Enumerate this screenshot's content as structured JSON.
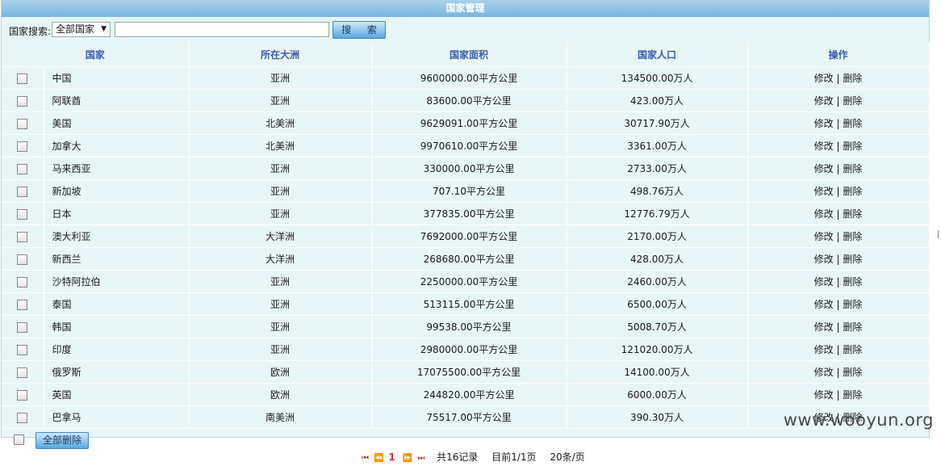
{
  "title": "国家管理",
  "search": {
    "label": "国家搜索:",
    "select_value": "全部国家",
    "input_value": "",
    "button_label": "搜 索"
  },
  "table": {
    "headers": [
      "国家",
      "所在大洲",
      "国家面积",
      "国家人口",
      "操作"
    ],
    "rows": [
      {
        "name": "中国",
        "continent": "亚洲",
        "area": "9600000.00平方公里",
        "population": "134500.00万人"
      },
      {
        "name": "阿联酋",
        "continent": "亚洲",
        "area": "83600.00平方公里",
        "population": "423.00万人"
      },
      {
        "name": "美国",
        "continent": "北美洲",
        "area": "9629091.00平方公里",
        "population": "30717.90万人"
      },
      {
        "name": "加拿大",
        "continent": "北美洲",
        "area": "9970610.00平方公里",
        "population": "3361.00万人"
      },
      {
        "name": "马来西亚",
        "continent": "亚洲",
        "area": "330000.00平方公里",
        "population": "2733.00万人"
      },
      {
        "name": "新加坡",
        "continent": "亚洲",
        "area": "707.10平方公里",
        "population": "498.76万人"
      },
      {
        "name": "日本",
        "continent": "亚洲",
        "area": "377835.00平方公里",
        "population": "12776.79万人"
      },
      {
        "name": "澳大利亚",
        "continent": "大洋洲",
        "area": "7692000.00平方公里",
        "population": "2170.00万人"
      },
      {
        "name": "新西兰",
        "continent": "大洋洲",
        "area": "268680.00平方公里",
        "population": "428.00万人"
      },
      {
        "name": "沙特阿拉伯",
        "continent": "亚洲",
        "area": "2250000.00平方公里",
        "population": "2460.00万人"
      },
      {
        "name": "泰国",
        "continent": "亚洲",
        "area": "513115.00平方公里",
        "population": "6500.00万人"
      },
      {
        "name": "韩国",
        "continent": "亚洲",
        "area": "99538.00平方公里",
        "population": "5008.70万人"
      },
      {
        "name": "印度",
        "continent": "亚洲",
        "area": "2980000.00平方公里",
        "population": "121020.00万人"
      },
      {
        "name": "俄罗斯",
        "continent": "欧洲",
        "area": "17075500.00平方公里",
        "population": "14100.00万人"
      },
      {
        "name": "英国",
        "continent": "欧洲",
        "area": "244820.00平方公里",
        "population": "6000.00万人"
      },
      {
        "name": "巴拿马",
        "continent": "南美洲",
        "area": "75517.00平方公里",
        "population": "390.30万人"
      }
    ],
    "edit_label": "修改",
    "separator": "|",
    "delete_label": "删除"
  },
  "footer": {
    "delete_all_label": "全部删除"
  },
  "pager": {
    "first_icon": "first-page-icon",
    "prev_icon": "prev-page-icon",
    "next_icon": "next-page-icon",
    "last_icon": "last-page-icon",
    "current_page": "1",
    "total_records": "共16记录",
    "page_info": "目前1/1页",
    "page_size": "20条/页"
  },
  "watermark": "www.wooyun.org"
}
